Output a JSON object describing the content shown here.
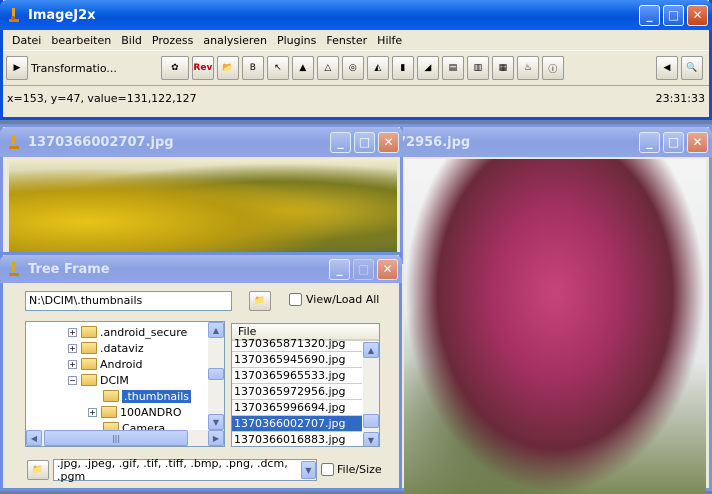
{
  "main": {
    "title": "ImageJ2x",
    "menu": [
      "Datei",
      "bearbeiten",
      "Bild",
      "Prozess",
      "analysieren",
      "Plugins",
      "Fenster",
      "Hilfe"
    ],
    "toolbar_label": "Transformatio...",
    "rev_label": "Rev",
    "status_left": "x=153, y=47, value=131,122,127",
    "status_right": "23:31:33"
  },
  "image1": {
    "title": "1370366002707.jpg"
  },
  "image2": {
    "title": "72956.jpg"
  },
  "tree": {
    "title": "Tree Frame",
    "path": "N:\\DCIM\\.thumbnails",
    "view_load": "View/Load All",
    "items": [
      ".android_secure",
      ".dataviz",
      "Android",
      "DCIM",
      ".thumbnails",
      "100ANDRO",
      "Camera"
    ],
    "file_header": "File",
    "files": [
      "1370365871320.jpg",
      "1370365945690.jpg",
      "1370365965533.jpg",
      "1370365972956.jpg",
      "1370365996694.jpg",
      "1370366002707.jpg",
      "1370366016883.jpg"
    ],
    "filter": ".jpg, .jpeg, .gif, .tif, .tiff, .bmp, .png, .dcm, .pgm",
    "file_size": "File/Size"
  },
  "colors": {
    "accent": "#0a5ee0",
    "selected": "#316ac5"
  }
}
